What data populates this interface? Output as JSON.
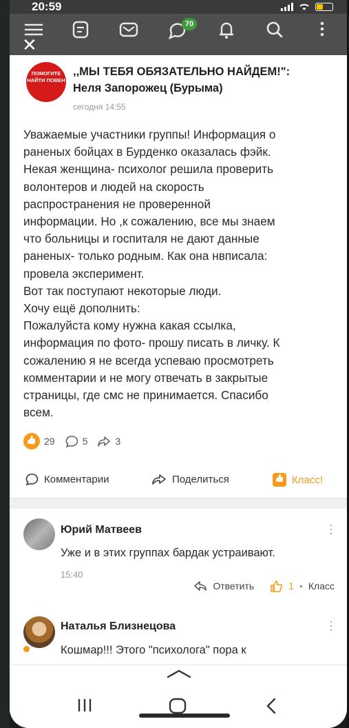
{
  "status": {
    "time": "20:59"
  },
  "nav": {
    "badge": "70"
  },
  "post": {
    "group_name": ",,МЫ ТЕБЯ ОБЯЗАТЕЛЬНО НАЙДЕМ!\":",
    "author": "Неля Запорожец (Бурыма)",
    "time": "сегодня 14:55",
    "logo_text": "ПОМОГИТЕ НАЙТИ ПОВЕН",
    "text": "Уважаемые участники группы! Информация о\nраненых бойцах в Бурденко оказалась фэйк.\nНекая женщина- психолог решила проверить\nволонтеров и людей на скорость\nраспространения не проверенной\nинформации. Но ,к сожалению, все мы знаем\nчто больницы и госпиталя не дают данные\nраненых- только родным. Как она нвписала:\nпровела эксперимент.\nВот так поступают некоторые люди.\nХочу ещё дополнить:\nПожалуйста кому нужна какая ссылка,\nинформация по фото- прошу писать в личку. К\nсожалению я не всегда успеваю просмотреть\nкомментарии и не могу отвечать в закрытые\nстраницы, где смс не принимается. Спасибо\nвсем.",
    "likes": "29",
    "comments": "5",
    "shares": "3"
  },
  "actions": {
    "comments_label": "Комментарии",
    "share_label": "Поделиться",
    "klass_label": "Класс!"
  },
  "comments": [
    {
      "name": "Юрий Матвеев",
      "text": "Уже и в этих группах бардак устраивают.",
      "time": "15:40",
      "reply_label": "Ответить",
      "likes": "1",
      "klass_label": "Класс"
    },
    {
      "name": "Наталья Близнецова",
      "text": "Кошмар!!! Этого \"психолога\" пора к"
    }
  ],
  "colors": {
    "accent": "#f59a1a",
    "nav_bg": "#4e4e4e",
    "logo_red": "#d41a1a",
    "badge_green": "#3d9a3a"
  }
}
